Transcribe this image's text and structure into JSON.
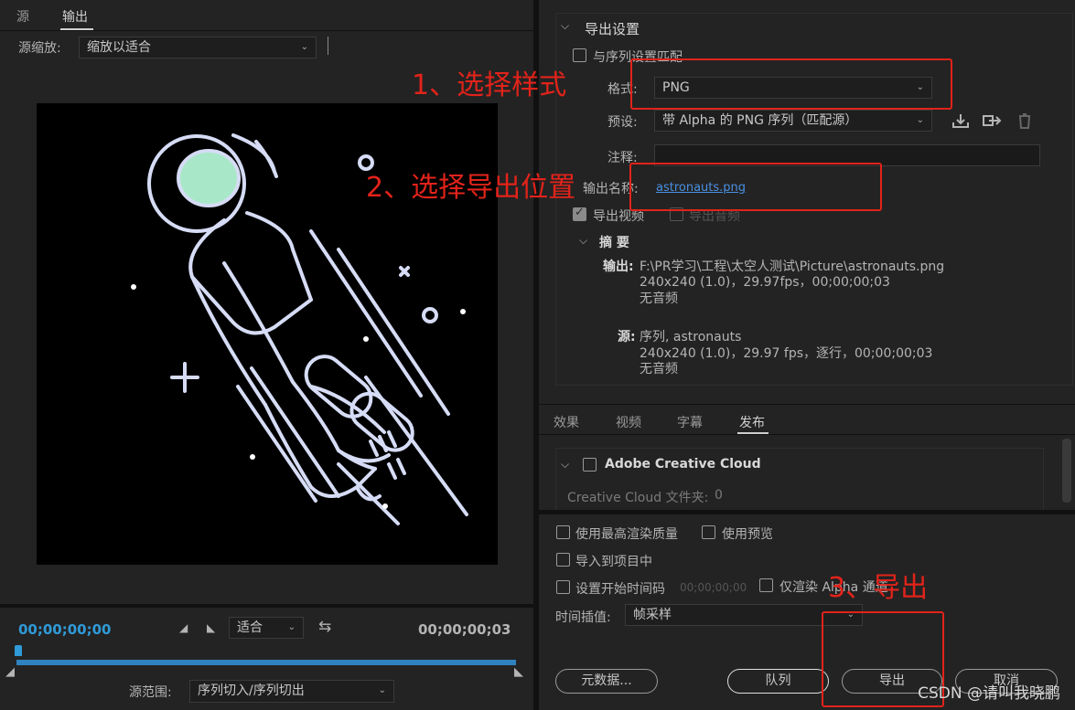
{
  "left": {
    "tabs": [
      {
        "label": "源",
        "active": false
      },
      {
        "label": "输出",
        "active": true
      }
    ],
    "scale": {
      "label": "源缩放:",
      "value": "缩放以适合"
    },
    "timeline": {
      "current_time": "00;00;00;00",
      "end_time": "00;00;00;03",
      "fit_value": "适合",
      "range_label": "源范围:",
      "range_value": "序列切入/序列切出",
      "accent": "#2f9bd9"
    }
  },
  "export_settings": {
    "title": "导出设置",
    "match_sequence": "与序列设置匹配",
    "format_label": "格式:",
    "format_value": "PNG",
    "preset_label": "预设:",
    "preset_value": "带 Alpha 的 PNG 序列（匹配源）",
    "comment_label": "注释:",
    "output_name_label": "输出名称:",
    "output_name_value": "astronauts.png",
    "export_video": "导出视频",
    "export_audio": "导出音频",
    "summary_title": "摘 要",
    "output_label": "输出:",
    "output_path": "F:\\PR学习\\工程\\太空人测试\\Picture\\astronauts.png",
    "output_spec": "240x240 (1.0)，29.97fps，00;00;00;03",
    "output_audio": "无音频",
    "source_label": "源:",
    "source_name": "序列, astronauts",
    "source_spec": "240x240 (1.0)，29.97 fps，逐行，00;00;00;03",
    "source_audio": "无音频"
  },
  "tabs2": [
    {
      "label": "效果",
      "active": false
    },
    {
      "label": "视频",
      "active": false
    },
    {
      "label": "字幕",
      "active": false
    },
    {
      "label": "发布",
      "active": true
    }
  ],
  "publish": {
    "cc_title": "Adobe Creative Cloud",
    "cc_folder_label": "Creative Cloud 文件夹:",
    "cc_folder_value": "0"
  },
  "bottom": {
    "max_quality": "使用最高渲染质量",
    "use_preview": "使用预览",
    "import_project": "导入到项目中",
    "set_start_tc": "设置开始时间码",
    "start_tc_value": "00;00;00;00",
    "alpha_only": "仅渲染 Alpha 通道",
    "time_interp_label": "时间插值:",
    "time_interp_value": "帧采样",
    "metadata_btn": "元数据...",
    "queue_btn": "队列",
    "export_btn": "导出",
    "cancel_btn": "取消"
  },
  "annotations": {
    "step1": "1、选择样式",
    "step2": "2、选择导出位置",
    "step3": "3、导出",
    "color": "#e2231a"
  },
  "watermark": "CSDN @请叫我晓鹏",
  "icons": [
    "chevron-down-icon",
    "play-in-icon",
    "play-out-icon",
    "loop-icon",
    "save-preset-icon",
    "import-preset-icon",
    "delete-preset-icon",
    "astronaut-preview-image"
  ]
}
